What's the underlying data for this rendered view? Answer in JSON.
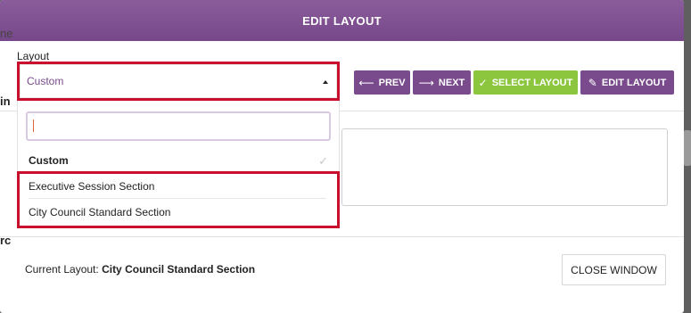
{
  "modal": {
    "title": "EDIT LAYOUT",
    "layout_label": "Layout",
    "selected_layout": "Custom"
  },
  "toolbar": {
    "prev_label": "PREV",
    "next_label": "NEXT",
    "select_label": "SELECT LAYOUT",
    "edit_label": "EDIT LAYOUT"
  },
  "dropdown": {
    "search_value": "",
    "options": [
      {
        "label": "Custom",
        "selected": true
      },
      {
        "label": "Executive Session Section",
        "selected": false
      },
      {
        "label": "City Council Standard Section",
        "selected": false
      }
    ]
  },
  "footer": {
    "current_label": "Current Layout:",
    "current_value": "City Council Standard Section",
    "close_label": "CLOSE WINDOW"
  },
  "backdrop": {
    "frag1": "ne",
    "frag2": "in",
    "frag3": "rc"
  },
  "colors": {
    "header": "#7a4b8c",
    "accent_purple": "#7a4b8c",
    "accent_green": "#8cc63f",
    "highlight_red": "#c8102e"
  }
}
